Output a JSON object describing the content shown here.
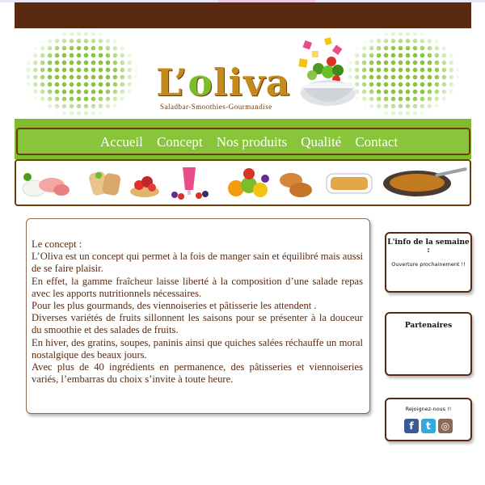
{
  "header": {
    "logo_prefix": "L’",
    "logo_o": "o",
    "logo_suffix": "liva",
    "tagline": "Saladbar-Smoothies-Gourmandise"
  },
  "nav": {
    "items": [
      {
        "label": "Accueil"
      },
      {
        "label": "Concept"
      },
      {
        "label": "Nos produits"
      },
      {
        "label": "Qualité"
      },
      {
        "label": "Contact"
      }
    ]
  },
  "main": {
    "title": "Le concept :",
    "paragraphs": [
      "L’Oliva est un concept qui permet à la fois de manger sain et équilibré mais aussi de se faire plaisir.",
      "En effet, la gamme fraîcheur laisse liberté à la composition d’une salade repas avec les apports nutritionnels nécessaires.",
      "Pour les plus gourmands, des viennoiseries et pâtisserie les attendent .",
      "Diverses variétés de fruits sillonnent les saisons pour se présenter à la douceur du smoothie et des salades de fruits.",
      "En hiver, des gratins, soupes, paninis ainsi que quiches salées réchauffe un moral nostalgique des beaux jours.",
      "Avec plus de 40 ingrédients en permanence, des pâtisseries et viennoiseries variés, l’embarras du choix s’invite à toute heure."
    ]
  },
  "sidebar": {
    "info_title": "L'info de la semaine :",
    "info_text": "Ouverture prochainement !!",
    "partners_title": "Partenaires",
    "join_text": "Rejoignez-nous !!",
    "social": [
      {
        "name": "facebook",
        "glyph": "f",
        "color": "#3b5998"
      },
      {
        "name": "twitter",
        "glyph": "t",
        "color": "#33aadd"
      },
      {
        "name": "instagram",
        "glyph": "◎",
        "color": "#8a6a55"
      }
    ]
  },
  "colors": {
    "brown": "#5a2a10",
    "green": "#7dbd2c",
    "logo_gold": "#c48a1c"
  }
}
